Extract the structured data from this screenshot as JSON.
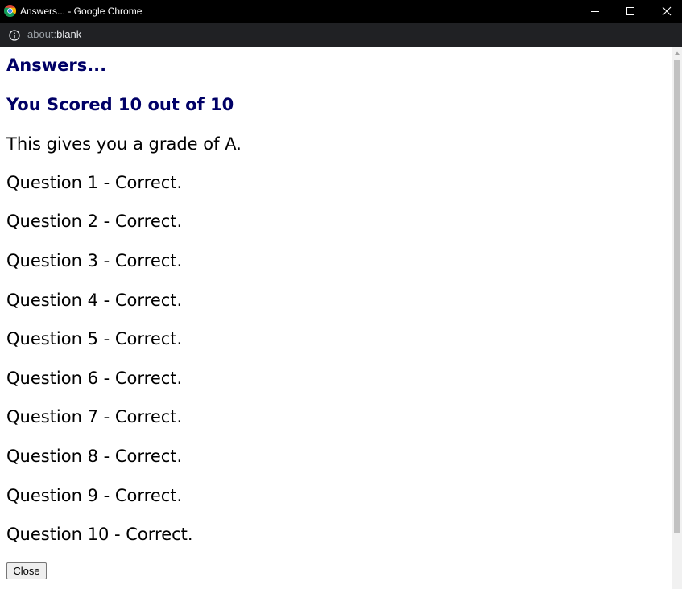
{
  "window": {
    "title": "Answers... - Google Chrome",
    "minimize_icon": "minimize-icon",
    "maximize_icon": "maximize-icon",
    "close_icon": "close-icon"
  },
  "addressbar": {
    "scheme": "about:",
    "host": "blank",
    "info_icon": "info-icon"
  },
  "page": {
    "heading": "Answers...",
    "score": "You Scored 10 out of 10",
    "grade_text": "This gives you a grade of A.",
    "results": [
      "Question 1 - Correct.",
      "Question 2 - Correct.",
      "Question 3 - Correct.",
      "Question 4 - Correct.",
      "Question 5 - Correct.",
      "Question 6 - Correct.",
      "Question 7 - Correct.",
      "Question 8 - Correct.",
      "Question 9 - Correct.",
      "Question 10 - Correct."
    ],
    "close_label": "Close"
  },
  "colors": {
    "heading": "#000066",
    "titlebar": "#000000",
    "addressbar": "#202124"
  }
}
